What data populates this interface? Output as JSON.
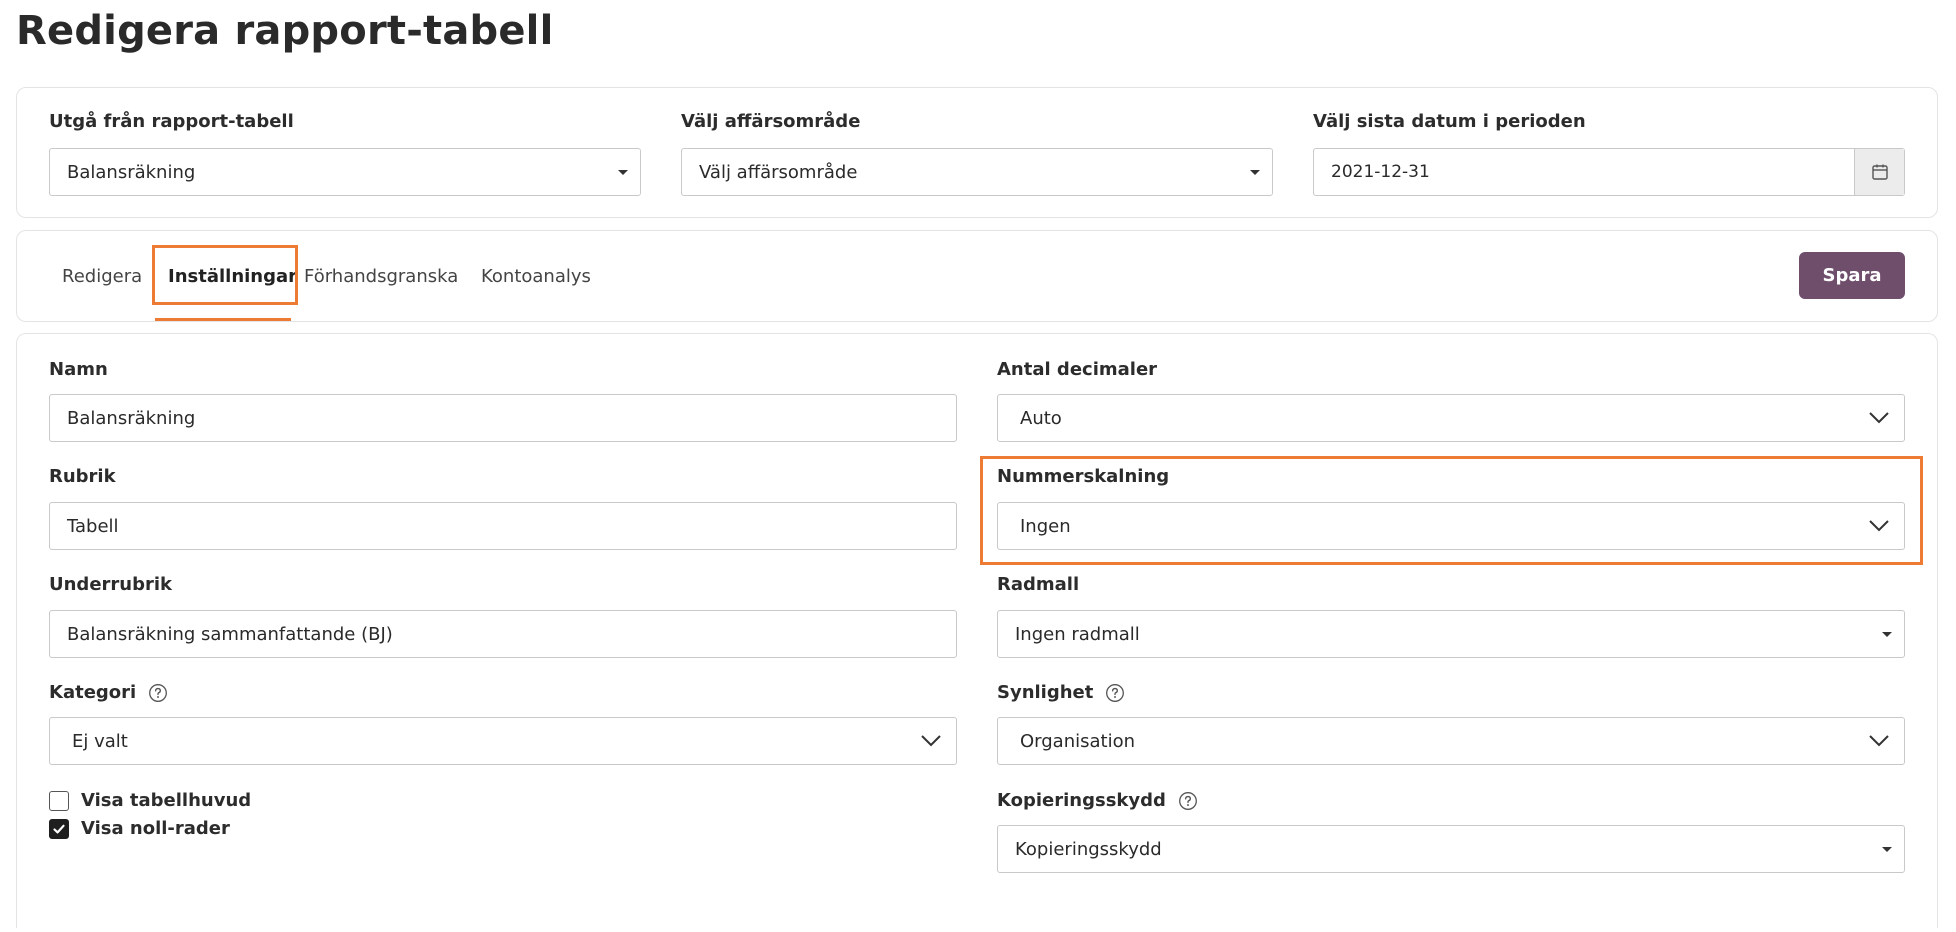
{
  "page": {
    "title": "Redigera rapport-tabell"
  },
  "top": {
    "base_table": {
      "label": "Utgå från rapport-tabell",
      "value": "Balansräkning"
    },
    "business_area": {
      "label": "Välj affärsområde",
      "value": "Välj affärsområde"
    },
    "period_end": {
      "label": "Välj sista datum i perioden",
      "value": "2021-12-31"
    }
  },
  "tabs": {
    "items": [
      {
        "label": "Redigera"
      },
      {
        "label": "Inställningar"
      },
      {
        "label": "Förhandsgranska"
      },
      {
        "label": "Kontoanalys"
      }
    ],
    "active": "Inställningar",
    "save_label": "Spara"
  },
  "settings": {
    "name": {
      "label": "Namn",
      "value": "Balansräkning"
    },
    "heading": {
      "label": "Rubrik",
      "value": "Tabell"
    },
    "subheading": {
      "label": "Underrubrik",
      "value": "Balansräkning sammanfattande (BJ)"
    },
    "category": {
      "label": "Kategori",
      "value": "Ej valt"
    },
    "show_header": {
      "label": "Visa tabellhuvud",
      "checked": false
    },
    "show_zero_rows": {
      "label": "Visa noll-rader",
      "checked": true
    },
    "decimals": {
      "label": "Antal decimaler",
      "value": "Auto"
    },
    "number_scaling": {
      "label": "Nummerskalning",
      "value": "Ingen"
    },
    "row_template": {
      "label": "Radmall",
      "value": "Ingen radmall"
    },
    "visibility": {
      "label": "Synlighet",
      "value": "Organisation"
    },
    "copy_protection": {
      "label": "Kopieringsskydd",
      "value": "Kopieringsskydd"
    }
  },
  "colors": {
    "accent": "#ed7b33",
    "primary_button": "#6f4e6c",
    "border": "#c9c9c9"
  },
  "icons": {
    "calendar": "calendar-icon",
    "help": "help-circle-icon",
    "chevron": "chevron-down-icon",
    "caret": "caret-down-icon",
    "check": "check-icon"
  }
}
